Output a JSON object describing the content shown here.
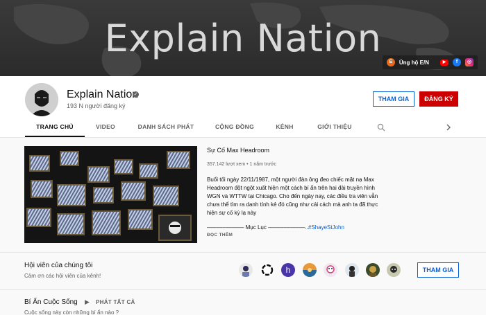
{
  "banner": {
    "title": "Explain Nation",
    "support_label": "Ủng hộ E/N",
    "social_icons": [
      "brand-icon",
      "youtube-icon",
      "facebook-icon",
      "instagram-icon"
    ]
  },
  "channel": {
    "name": "Explain Nation",
    "subscribers": "193 N người đăng ký",
    "join_label": "THAM GIA",
    "subscribe_label": "ĐĂNG KÝ",
    "colors": {
      "subscribe": "#cc0000",
      "join": "#065fd4"
    }
  },
  "tabs": [
    {
      "label": "TRANG CHỦ"
    },
    {
      "label": "VIDEO"
    },
    {
      "label": "DANH SÁCH PHÁT"
    },
    {
      "label": "CỘNG ĐỒNG"
    },
    {
      "label": "KÊNH"
    },
    {
      "label": "GIỚI THIỆU"
    }
  ],
  "featured": {
    "title": "Sự Cố Max Headroom",
    "meta": "357.142 lượt xem • 1 năm trước",
    "description": "Buổi tối ngày 22/11/1987, một người đàn ông đeo chiếc mặt nạ Max Headroom đột ngột xuất hiện một cách bí ẩn trên hai đài truyền hình WGN và WTTW tại Chicago. Cho đến ngày nay, các điều tra viên vẫn chưa thể tìm ra danh tính kẻ đó cũng như cái cách mà anh ta đã thực hiện sự cố kỳ lạ này",
    "toc": "–––––––––––– Mục Lục ––––––––––––..",
    "hashtag": "#ShayeStJohn",
    "read_more": "ĐỌC THÊM"
  },
  "members": {
    "title": "Hội viên của chúng tôi",
    "subtitle": "Cảm ơn các hội viên của kênh!",
    "join_label": "THAM GIA",
    "avatar_letter": "h"
  },
  "playlist": {
    "title": "Bí Ẩn Cuộc Sống",
    "play_all": "PHÁT TẤT CẢ",
    "subtitle": "Cuộc sống này còn những bí ẩn nào ?"
  }
}
